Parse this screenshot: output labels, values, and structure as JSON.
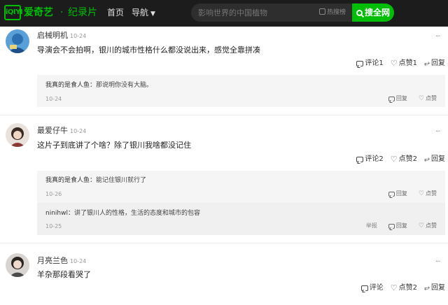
{
  "header": {
    "logo_text": "iQIYI",
    "brand": "爱奇艺",
    "dot": "·",
    "channel": "纪录片",
    "nav": {
      "home": "首页",
      "guide": "导航"
    },
    "search": {
      "placeholder": "影响世界的中国植物",
      "hot_rank": "热搜榜",
      "button": "搜全网"
    },
    "colors": {
      "bar": "#1c1c1c",
      "accent": "#00be06"
    }
  },
  "comments": [
    {
      "user": "启械明机",
      "date": "10-24",
      "text": "导演会不会拍啊，银川的城市性格什么都没说出来，感觉全靠拼凑",
      "actions": {
        "comment": "评论1",
        "like": "点赞1",
        "share": "回复"
      },
      "replies": [
        {
          "user": "我真的是食人鱼",
          "sep": "：",
          "text": "那说明你没有大脑。",
          "date": "10-24",
          "reply": "回复",
          "like": "点赞"
        }
      ]
    },
    {
      "user": "最爱仔牛",
      "date": "10-24",
      "text": "这片子到底讲了个啥？除了银川我啥都没记住",
      "actions": {
        "comment": "评论2",
        "like": "点赞2",
        "share": "回复"
      },
      "replies": [
        {
          "user": "我真的是食人鱼",
          "sep": "：",
          "text": "能记住银川就行了",
          "date": "10-26",
          "reply": "回复",
          "like": "点赞"
        },
        {
          "user": "ninihwl",
          "sep": "：",
          "text": "讲了银川人的性格，生活的态度和城市的包容",
          "date": "10-25",
          "report": "举报",
          "reply": "回复",
          "like": "点赞"
        }
      ]
    },
    {
      "user": "月亮兰色",
      "date": "10-24",
      "text": "羊杂那段看哭了",
      "actions": {
        "comment": "评论",
        "like": "点赞2",
        "share": "回复"
      }
    }
  ],
  "more_icon": "···"
}
